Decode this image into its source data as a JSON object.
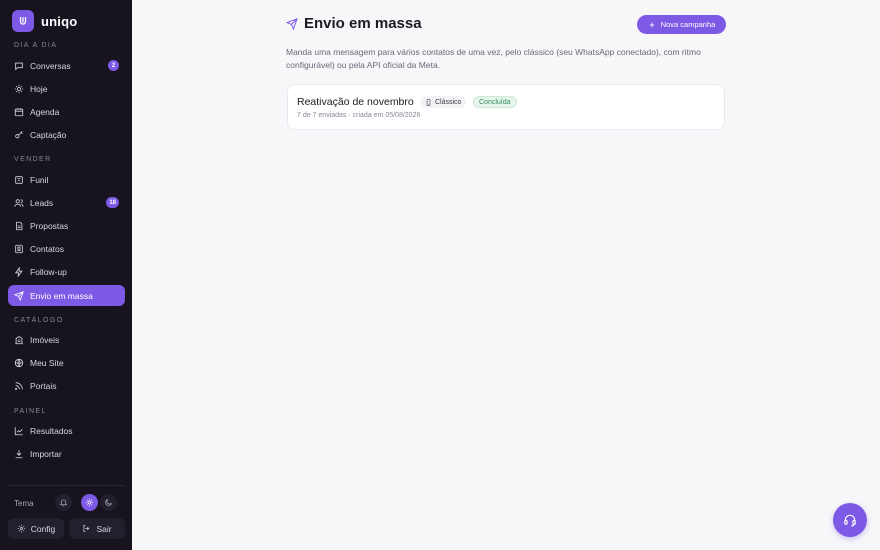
{
  "brand": {
    "name": "uniqo"
  },
  "colors": {
    "accent": "#7c5ae6",
    "sidebar_bg": "#17141f",
    "success": "#2e8a55"
  },
  "sidebar": {
    "sections": [
      {
        "label": "DIA A DIA"
      },
      {
        "label": "VENDER"
      },
      {
        "label": "CATÁLOGO"
      },
      {
        "label": "PAINEL"
      }
    ],
    "items": [
      {
        "label": "Conversas",
        "icon": "chat-icon",
        "badge": "2"
      },
      {
        "label": "Hoje",
        "icon": "sun-icon"
      },
      {
        "label": "Agenda",
        "icon": "calendar-icon"
      },
      {
        "label": "Captação",
        "icon": "key-icon"
      },
      {
        "label": "Funil",
        "icon": "funnel-icon"
      },
      {
        "label": "Leads",
        "icon": "users-icon",
        "badge": "18"
      },
      {
        "label": "Propostas",
        "icon": "document-icon"
      },
      {
        "label": "Contatos",
        "icon": "contact-card-icon"
      },
      {
        "label": "Follow-up",
        "icon": "lightning-icon"
      },
      {
        "label": "Envio em massa",
        "icon": "send-icon",
        "active": true
      },
      {
        "label": "Imóveis",
        "icon": "building-icon"
      },
      {
        "label": "Meu Site",
        "icon": "globe-icon"
      },
      {
        "label": "Portais",
        "icon": "rss-icon"
      },
      {
        "label": "Resultados",
        "icon": "chart-icon"
      },
      {
        "label": "Importar",
        "icon": "download-icon"
      }
    ],
    "theme_label": "Tema",
    "config_label": "Config",
    "logout_label": "Sair"
  },
  "main": {
    "title": "Envio em massa",
    "new_button": "Nova campanha",
    "description": "Manda uma mensagem para vários contatos de uma vez, pelo clássico (seu WhatsApp conectado), com ritmo configurável) ou pela API oficial da Meta.",
    "campaigns": [
      {
        "name": "Reativação de novembro",
        "type": "Clássico",
        "status": "Concluída",
        "meta": "7 de 7 enviadas · criada em 05/08/2026"
      }
    ]
  }
}
